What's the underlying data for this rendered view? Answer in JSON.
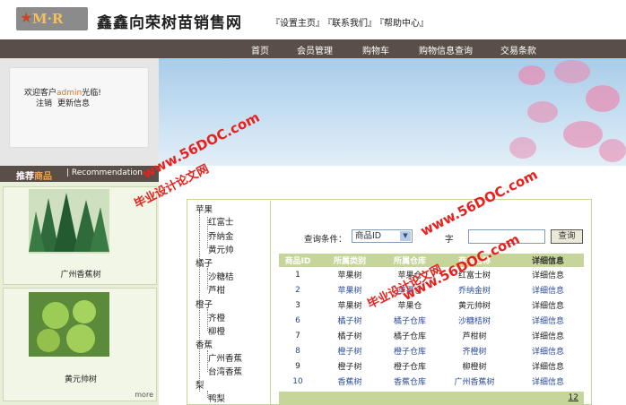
{
  "header": {
    "logo_text": "M·R",
    "site_title": "鑫鑫向荣树苗销售网",
    "links": [
      "『设置主页』",
      "『联系我们』",
      "『帮助中心』"
    ]
  },
  "nav": {
    "items": [
      "首页",
      "会员管理",
      "购物车",
      "购物信息查询",
      "交易条款"
    ]
  },
  "login": {
    "welcome_prefix": "欢迎客户",
    "username": "admin",
    "welcome_suffix": "光临!",
    "logout": "注销",
    "update": "更新信息"
  },
  "recommend": {
    "title_plain": "推荐",
    "title_highlight": "商品",
    "separator": "|",
    "en": "Recommendation"
  },
  "products": [
    {
      "name": "广州香蕉树",
      "icon": "pine-tree-image"
    },
    {
      "name": "黄元帅树",
      "icon": "green-apple-image"
    }
  ],
  "more": "more",
  "tree": {
    "groups": [
      {
        "label": "苹果",
        "children": [
          "红富士",
          "乔纳金",
          "黄元帅"
        ]
      },
      {
        "label": "橘子",
        "children": [
          "沙糖桔",
          "芦柑"
        ]
      },
      {
        "label": "橙子",
        "children": [
          "齐橙",
          "柳橙"
        ]
      },
      {
        "label": "香蕉",
        "children": [
          "广州香蕉",
          "台湾香蕉"
        ]
      },
      {
        "label": "梨",
        "children": [
          "鸭梨"
        ]
      }
    ]
  },
  "query": {
    "label": "查询条件：",
    "select_value": "商品ID",
    "keyword_label": "字",
    "button": "查询"
  },
  "table": {
    "headers": [
      "商品ID",
      "所属类别",
      "所属仓库",
      "商品名称",
      "详细信息"
    ],
    "rows": [
      [
        "1",
        "苹果树",
        "苹果仓",
        "红富士树",
        "详细信息"
      ],
      [
        "2",
        "苹果树",
        "苹果仓",
        "乔纳金树",
        "详细信息"
      ],
      [
        "3",
        "苹果树",
        "苹果仓",
        "黄元帅树",
        "详细信息"
      ],
      [
        "6",
        "橘子树",
        "橘子仓库",
        "沙糖桔树",
        "详细信息"
      ],
      [
        "7",
        "橘子树",
        "橘子仓库",
        "芦柑树",
        "详细信息"
      ],
      [
        "8",
        "橙子树",
        "橙子仓库",
        "齐橙树",
        "详细信息"
      ],
      [
        "9",
        "橙子树",
        "橙子仓库",
        "柳橙树",
        "详细信息"
      ],
      [
        "10",
        "香蕉树",
        "香蕉仓库",
        "广州香蕉树",
        "详细信息"
      ]
    ]
  },
  "pager": [
    "1",
    "2"
  ],
  "watermarks": [
    "www.56DOC.com",
    "毕业设计论文网",
    "www.56DOC.com",
    "毕业设计论文网",
    "www.56DOC.com"
  ],
  "colors": {
    "nav_bg": "#5a4e48",
    "accent_green": "#c6d69a",
    "watermark": "#e8211d",
    "link_blue": "#2a4a9a"
  }
}
